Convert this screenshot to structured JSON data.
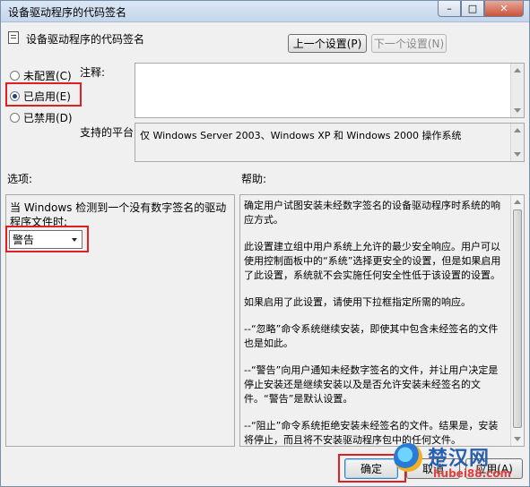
{
  "window": {
    "title": "设备驱动程序的代码签名",
    "controls": {
      "minimize": "–",
      "maximize": "□",
      "close": "✕"
    }
  },
  "header": {
    "policy_title": "设备驱动程序的代码签名",
    "prev_button": "上一个设置(P)",
    "next_button": "下一个设置(N)"
  },
  "radios": [
    {
      "label": "未配置(C)",
      "selected": false
    },
    {
      "label": "已启用(E)",
      "selected": true
    },
    {
      "label": "已禁用(D)",
      "selected": false
    }
  ],
  "comment": {
    "label": "注释:",
    "value": ""
  },
  "platform": {
    "label": "支持的平台:",
    "value": "仅 Windows Server 2003、Windows XP 和 Windows 2000 操作系统"
  },
  "options": {
    "label": "选项:",
    "description": "当 Windows 检测到一个没有数字签名的驱动程序文件时:",
    "dropdown_value": "警告"
  },
  "help": {
    "label": "帮助:",
    "paragraphs": [
      "确定用户试图安装未经数字签名的设备驱动程序时系统的响应方式。",
      "此设置建立组中用户系统上允许的最少安全响应。用户可以使用控制面板中的“系统”选择更安全的设置，但是如果启用了此设置，系统就不会实施任何安全性低于该设置的设置。",
      "如果启用了此设置，请使用下拉框指定所需的响应。",
      "--“忽略”命令系统继续安装，即使其中包含未经签名的文件也是如此。",
      "--“警告”向用户通知未经数字签名的文件，并让用户决定是停止安装还是继续安装以及是否允许安装未经签名的文件。“警告”是默认设置。",
      "--“阻止”命令系统拒绝安装未经签名的文件。结果是，安装将停止，而且将不安装驱动程序包中的任何文件。"
    ]
  },
  "footer": {
    "ok_button": "确定",
    "cancel_button": "取消",
    "apply_button": "应用(A)"
  },
  "watermark": {
    "name": "楚汉网",
    "url": "hubei88.com"
  },
  "colors": {
    "highlight": "#e02020",
    "accent": "#1f3f8a"
  }
}
